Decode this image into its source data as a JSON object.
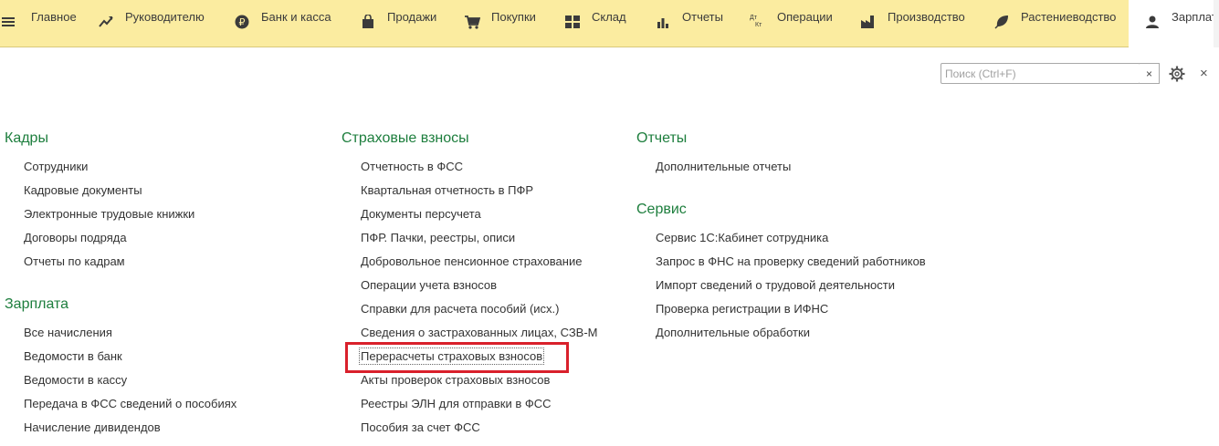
{
  "topbar": {
    "items": [
      {
        "label": "Главное",
        "icon": "menu-icon"
      },
      {
        "label": "Руководителю",
        "icon": "trend-icon"
      },
      {
        "label": "Банк и касса",
        "icon": "ruble-icon"
      },
      {
        "label": "Продажи",
        "icon": "bag-icon"
      },
      {
        "label": "Покупки",
        "icon": "cart-icon"
      },
      {
        "label": "Склад",
        "icon": "grid-icon"
      },
      {
        "label": "Отчеты",
        "icon": "bar-chart-icon"
      },
      {
        "label": "Операции",
        "icon": "dt-kt-icon"
      },
      {
        "label": "Производство",
        "icon": "factory-icon"
      },
      {
        "label": "Растениеводство",
        "icon": "leaf-icon"
      },
      {
        "label": "Зарплата",
        "icon": "person-icon"
      }
    ],
    "dt_kt": {
      "dt": "Дт",
      "kt": "Кт"
    }
  },
  "search": {
    "placeholder": "Поиск (Ctrl+F)",
    "value": "",
    "clear": "×"
  },
  "close_label": "×",
  "groups": {
    "kadry": {
      "title": "Кадры",
      "items": [
        "Сотрудники",
        "Кадровые документы",
        "Электронные трудовые книжки",
        "Договоры подряда",
        "Отчеты по кадрам"
      ]
    },
    "zarplata": {
      "title": "Зарплата",
      "items": [
        "Все начисления",
        "Ведомости в банк",
        "Ведомости в кассу",
        "Передача в ФСС сведений о пособиях",
        "Начисление дивидендов"
      ]
    },
    "vznosy": {
      "title": "Страховые взносы",
      "items": [
        "Отчетность в ФСС",
        "Квартальная отчетность в ПФР",
        "Документы персучета",
        "ПФР. Пачки, реестры, описи",
        "Добровольное пенсионное страхование",
        "Операции учета взносов",
        "Справки для расчета пособий (исх.)",
        "Сведения о застрахованных лицах, СЗВ-М",
        "Перерасчеты страховых взносов",
        "Акты проверок страховых взносов",
        "Реестры ЭЛН для отправки в ФСС",
        "Пособия за счет ФСС"
      ]
    },
    "otchety": {
      "title": "Отчеты",
      "items": [
        "Дополнительные отчеты"
      ]
    },
    "servis": {
      "title": "Сервис",
      "items": [
        "Сервис 1С:Кабинет сотрудника",
        "Запрос в ФНС на проверку сведений работников",
        "Импорт сведений о трудовой деятельности",
        "Проверка регистрации в ИФНС",
        "Дополнительные обработки"
      ]
    }
  },
  "colors": {
    "group_title": "#1d7e3d",
    "topbar_bg": "#fbeca0",
    "highlight": "#d9202b"
  }
}
